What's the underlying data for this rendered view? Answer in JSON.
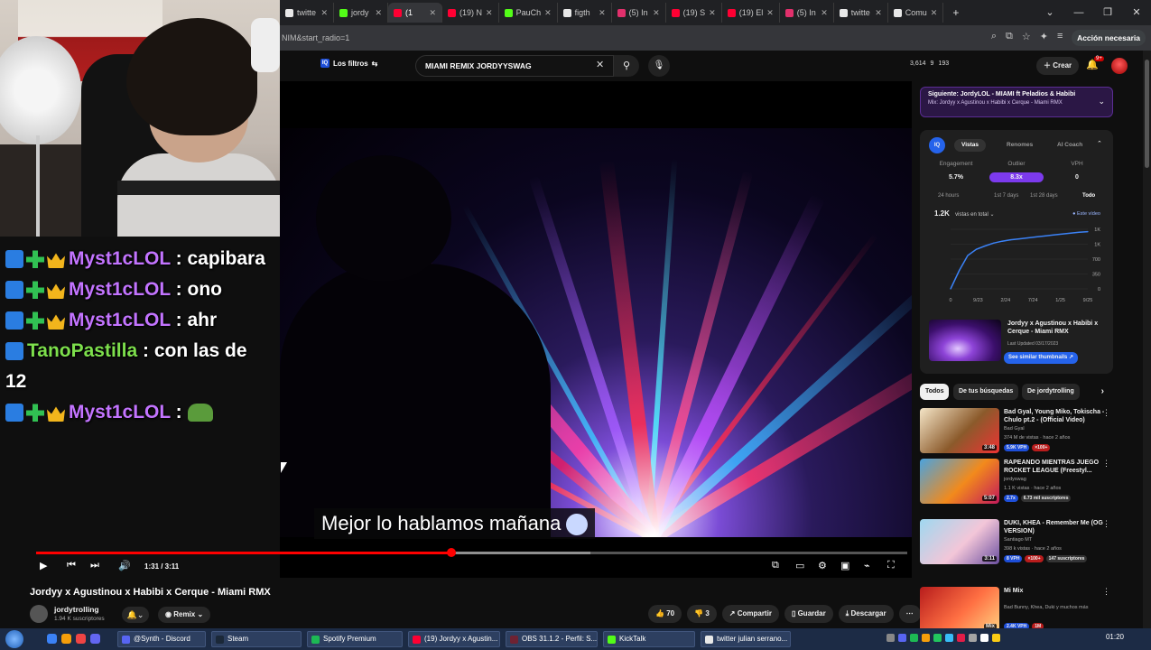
{
  "browser": {
    "tabs": [
      {
        "label": "twitte",
        "color": "#e8e8e8",
        "active": false
      },
      {
        "label": "jordy",
        "color": "#53fc18",
        "active": false
      },
      {
        "label": "(1",
        "color": "#ff0033",
        "active": true
      },
      {
        "label": "(19) N",
        "color": "#ff0033",
        "active": false
      },
      {
        "label": "PauCh",
        "color": "#53fc18",
        "active": false
      },
      {
        "label": "figth",
        "color": "#e8e8e8",
        "active": false
      },
      {
        "label": "(5) In",
        "color": "#e1306c",
        "active": false
      },
      {
        "label": "(19) S",
        "color": "#ff0033",
        "active": false
      },
      {
        "label": "(19) El",
        "color": "#ff0033",
        "active": false
      },
      {
        "label": "(5) In",
        "color": "#e1306c",
        "active": false
      },
      {
        "label": "twitte",
        "color": "#e8e8e8",
        "active": false
      },
      {
        "label": "Comu",
        "color": "#e8e8e8",
        "active": false
      }
    ],
    "new_tab": "+",
    "url": "NIM&start_radio=1",
    "action_button": "Acción necesaria"
  },
  "youtube_header": {
    "filters_label": "Los filtros",
    "search_value": "MIAMI REMIX JORDYYSWAG",
    "stats": [
      "3,614",
      "9",
      "193"
    ],
    "create_label": "Crear",
    "bell_badge": "9+"
  },
  "chat": {
    "lines": [
      {
        "user": "Myst1cLOL",
        "badges": true,
        "color": "purple",
        "message": "capibara",
        "wrap": true
      },
      {
        "user": "Myst1cLOL",
        "badges": true,
        "color": "purple",
        "message": "ono",
        "wrap": false
      },
      {
        "user": "Myst1cLOL",
        "badges": true,
        "color": "purple",
        "message": "ahr",
        "wrap": false
      },
      {
        "user": "TanoPastilla",
        "badges": false,
        "color": "green",
        "message": "con las de 12",
        "wrap": true
      },
      {
        "user": "Myst1cLOL",
        "badges": true,
        "color": "purple",
        "message": "",
        "emote": "pepe-emote",
        "wrap": false
      }
    ]
  },
  "video": {
    "subtitle": "Mejor lo hablamos mañana",
    "time": "1:31 / 3:11",
    "progress": 0.477,
    "buffered": 0.636,
    "title": "Jordyy x Agustinou x Habibi x Cerque - Miami RMX",
    "channel": "jordytrolling",
    "subscribers": "1.94 K suscriptores",
    "remix_label": "Remix",
    "likes": "70",
    "dislikes": "3",
    "share": "Compartir",
    "save": "Guardar",
    "download": "Descargar"
  },
  "up_next": {
    "title": "Siguiente: JordyLOL - MIAMI ft Peladios & Habibi",
    "subtitle": "Mix: Jordyy x Agustinou x Habibi x Cerque - Miami RMX"
  },
  "stats_panel": {
    "tabs": [
      "Vistas",
      "Renomes",
      "AI Coach"
    ],
    "metric_labels": [
      "Engagement",
      "Outlier",
      "VPH"
    ],
    "metric_values": [
      "5.7%",
      "8.3x",
      "0"
    ],
    "periods": [
      "24 hours",
      "1st 7 days",
      "1st 28 days",
      "Todo"
    ],
    "views": "1.2K",
    "views_label": "vistas en total",
    "legend": "Este vídeo",
    "thumb_title": "Jordyy x Agustinou x Habibi x Cerque - Miami RMX",
    "thumb_date": "Last Updated 03/17/2023",
    "similar_button": "See similar thumbnails"
  },
  "chart_data": {
    "type": "line",
    "x_ticks": [
      "0",
      "9/23",
      "2/24",
      "7/24",
      "1/25",
      "9/25"
    ],
    "y_ticks": [
      "1K",
      "1K",
      "700",
      "350",
      "0"
    ],
    "series": [
      {
        "values": [
          0,
          380,
          700,
          830,
          900,
          960,
          1000,
          1030,
          1050,
          1070,
          1090,
          1110,
          1130,
          1150,
          1170,
          1190,
          1200
        ]
      }
    ],
    "ylim": [
      0,
      1250
    ],
    "grid": true
  },
  "rec_filters": [
    "Todos",
    "De tus búsquedas",
    "De jordytrolling"
  ],
  "recommendations": [
    {
      "title": "Bad Gyal, Young Miko, Tokischa - Chulo pt.2 - (Official Video)",
      "channel": "Bad Gyal",
      "meta": "374 M de vistas · hace 2 años",
      "pills": [
        "5.9K VPH",
        "×100+"
      ],
      "duration": "3:48",
      "colors": [
        "#f5e6c8",
        "#8b5a2b",
        "#e33"
      ]
    },
    {
      "title": "RAPEANDO MIENTRAS JUEGO ROCKET LEAGUE (Freestyl...",
      "channel": "jordyswag",
      "meta": "1.1 K vistas · hace 2 años",
      "pills": [
        "2.7x",
        "6.73 mil suscriptores"
      ],
      "duration": "5:07",
      "colors": [
        "#4aa3df",
        "#f28a1c",
        "#c2185b"
      ]
    },
    {
      "title": "DUKI, KHEA - Remember Me (OG VERSION)",
      "channel": "Santiago MT",
      "meta": "398 k vistas · hace 2 años",
      "pills": [
        "8 VPH",
        "×100+",
        "147 suscriptores"
      ],
      "duration": "3:11",
      "colors": [
        "#9fd8f0",
        "#f3c6d8",
        "#6b4fa0"
      ]
    },
    {
      "title": "Mi Mix",
      "channel": "Bad Bunny, Khea, Duki y muchos más",
      "meta": "",
      "pills": [
        "2.4K VPH",
        "1M"
      ],
      "duration": "Mix",
      "colors": [
        "#b71c1c",
        "#ff7043",
        "#ffd180"
      ]
    }
  ],
  "taskbar": {
    "items": [
      {
        "label": "@Synth - Discord",
        "color": "#5865f2"
      },
      {
        "label": "Steam",
        "color": "#1b2838"
      },
      {
        "label": "Spotify Premium",
        "color": "#1db954"
      },
      {
        "label": "(19) Jordyy x Agustin...",
        "color": "#ff0033"
      },
      {
        "label": "OBS 31.1.2 - Perfil: S...",
        "color": "#6f2232"
      },
      {
        "label": "KickTalk",
        "color": "#53fc18"
      },
      {
        "label": "twitter julian serrano...",
        "color": "#e8e8e8"
      }
    ],
    "clock": "01:20"
  }
}
